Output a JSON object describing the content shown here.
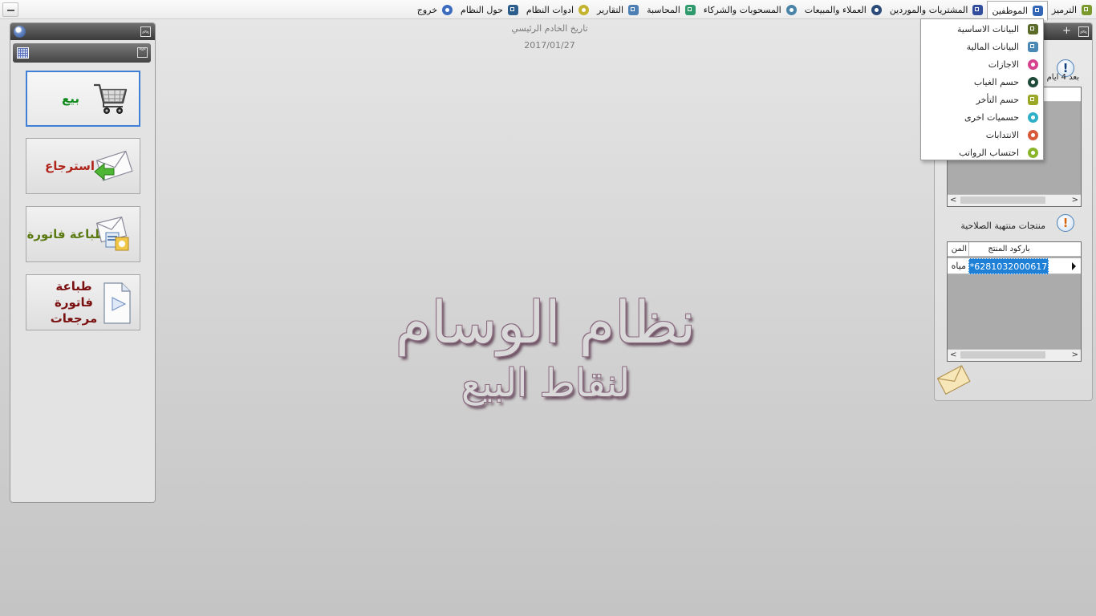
{
  "menu": {
    "items": [
      {
        "label": "الترميز",
        "icon": "coding-icon",
        "color": "#7a9a2e"
      },
      {
        "label": "الموظفين",
        "icon": "employees-icon",
        "color": "#3466b8",
        "active": true
      },
      {
        "label": "المشتريات والموردين",
        "icon": "purchases-icon",
        "color": "#324d9c"
      },
      {
        "label": "العملاء والمبيعات",
        "icon": "customers-icon",
        "color": "#2a4a7a"
      },
      {
        "label": "المسحوبات والشركاء",
        "icon": "withdrawals-icon",
        "color": "#4a84a8"
      },
      {
        "label": "المحاسبة",
        "icon": "accounting-icon",
        "color": "#2f9b6d"
      },
      {
        "label": "التقارير",
        "icon": "reports-icon",
        "color": "#4d7fb5"
      },
      {
        "label": "ادوات النظام",
        "icon": "tools-icon",
        "color": "#c3b32e"
      },
      {
        "label": "حول النظام",
        "icon": "about-icon",
        "color": "#2d5d8a"
      },
      {
        "label": "خروج",
        "icon": "exit-icon",
        "color": "#3c6cbf"
      }
    ]
  },
  "dropdown": {
    "items": [
      {
        "label": "البيانات الاساسية",
        "icon": "basic-data-icon",
        "color": "#5a6b2a"
      },
      {
        "label": "البيانات المالية",
        "icon": "financial-data-icon",
        "color": "#4a88b5"
      },
      {
        "label": "الاجازات",
        "icon": "vacations-icon",
        "color": "#d6428e"
      },
      {
        "label": "حسم الغياب",
        "icon": "absence-deduction-icon",
        "color": "#1f4a3a"
      },
      {
        "label": "حسم التأخر",
        "icon": "delay-deduction-icon",
        "color": "#9aa825"
      },
      {
        "label": "حسميات اخرى",
        "icon": "other-deductions-icon",
        "color": "#2fb0c8"
      },
      {
        "label": "الانتدابات",
        "icon": "assignments-icon",
        "color": "#d8583a"
      },
      {
        "label": "احتساب الرواتب",
        "icon": "salaries-icon",
        "color": "#8ab52a"
      }
    ]
  },
  "left_panel": {
    "buttons": [
      {
        "label": "بيع",
        "icon": "cart-icon",
        "color": "#0f8a1b"
      },
      {
        "label": "استرجاع",
        "icon": "return-envelope-icon",
        "color": "#b0241c"
      },
      {
        "label": "طباعة فاتورة",
        "icon": "print-invoice-icon",
        "color": "#5b7a14"
      },
      {
        "label": "طباعة فاتورة مرجعات",
        "icon": "print-returns-icon",
        "color": "#7a1010"
      }
    ]
  },
  "center": {
    "server_date_label": "تاريخ الخادم الرئيسي",
    "server_date": "2017/01/27",
    "logo_title": "نظام الوسام",
    "logo_subtitle": "لنقاط البيع"
  },
  "right_panel": {
    "top_alert_fragment": "بعد 4 أيام",
    "expired_title": "منتجات منتهية الصلاحية",
    "expired_grid": {
      "columns": [
        "باركود المنتج",
        "المن"
      ],
      "rows": [
        {
          "barcode": "*6281032000617",
          "name": "مياه"
        }
      ]
    }
  }
}
